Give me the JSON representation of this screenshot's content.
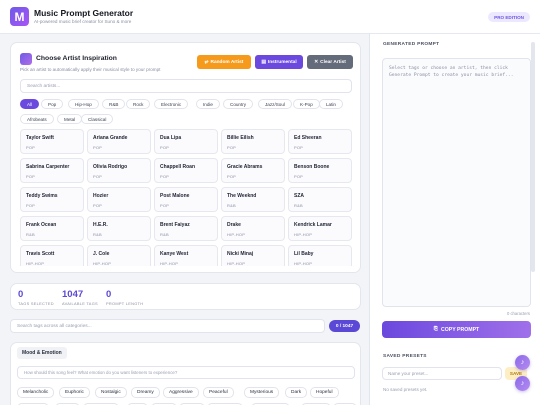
{
  "app": {
    "title": "Music Prompt Generator",
    "subtitle": "AI-powered music brief creator for Suno & more",
    "badge": "PRO EDITION",
    "logo_letter": "M"
  },
  "inspiration": {
    "title": "Choose Artist Inspiration",
    "subtitle": "Pick an artist to automatically apply their musical style to your prompt",
    "random_label": "Random Artist",
    "instrumental_label": "Instrumental",
    "clear_label": "Clear Artist",
    "search_placeholder": "Search artists...",
    "genres": [
      "All",
      "Pop",
      "Hip-Hop",
      "R&B",
      "Rock",
      "Electronic",
      "Indie",
      "Country",
      "Jazz/Soul",
      "K-Pop",
      "Latin",
      "Afrobeats",
      "Metal",
      "Classical"
    ],
    "active_genre": "All",
    "artists": [
      {
        "name": "Taylor Swift",
        "genre": "POP"
      },
      {
        "name": "Ariana Grande",
        "genre": "POP"
      },
      {
        "name": "Dua Lipa",
        "genre": "POP"
      },
      {
        "name": "Billie Eilish",
        "genre": "POP"
      },
      {
        "name": "Ed Sheeran",
        "genre": "POP"
      },
      {
        "name": "Sabrina Carpenter",
        "genre": "POP"
      },
      {
        "name": "Olivia Rodrigo",
        "genre": "POP"
      },
      {
        "name": "Chappell Roan",
        "genre": "POP"
      },
      {
        "name": "Gracie Abrams",
        "genre": "POP"
      },
      {
        "name": "Benson Boone",
        "genre": "POP"
      },
      {
        "name": "Teddy Swims",
        "genre": "POP"
      },
      {
        "name": "Hozier",
        "genre": "POP"
      },
      {
        "name": "Post Malone",
        "genre": "POP"
      },
      {
        "name": "The Weeknd",
        "genre": "R&B"
      },
      {
        "name": "SZA",
        "genre": "R&B"
      },
      {
        "name": "Frank Ocean",
        "genre": "R&B"
      },
      {
        "name": "H.E.R.",
        "genre": "R&B"
      },
      {
        "name": "Brent Faiyaz",
        "genre": "R&B"
      },
      {
        "name": "Drake",
        "genre": "HIP-HOP"
      },
      {
        "name": "Kendrick Lamar",
        "genre": "HIP-HOP"
      },
      {
        "name": "Travis Scott",
        "genre": "HIP-HOP"
      },
      {
        "name": "J. Cole",
        "genre": "HIP-HOP"
      },
      {
        "name": "Kanye West",
        "genre": "HIP-HOP"
      },
      {
        "name": "Nicki Minaj",
        "genre": "HIP-HOP"
      },
      {
        "name": "Lil Baby",
        "genre": "HIP-HOP"
      }
    ]
  },
  "stats": {
    "tags_selected": "0",
    "tags_selected_label": "TAGS SELECTED",
    "available_tags": "1047",
    "available_tags_label": "AVAILABLE TAGS",
    "prompt_length": "0",
    "prompt_length_label": "PROMPT LENGTH"
  },
  "category_search": {
    "placeholder": "Search tags across all categories...",
    "count": "0 / 1047"
  },
  "mood": {
    "tab_label": "Mood & Emotion",
    "input_placeholder": "How should this song feel? What emotion do you want listeners to experience?",
    "chips": [
      "Melancholic",
      "Euphoric",
      "Nostalgic",
      "Dreamy",
      "Aggressive",
      "Peaceful",
      "Mysterious",
      "Dark",
      "Hopeful"
    ],
    "chips_row2": [
      "Romantic",
      "Angry",
      "Bittersweet",
      "Epic",
      "Playful",
      "Lonely",
      "Triumphant",
      "Introspective",
      "Ethereal",
      "Sultry"
    ]
  },
  "generated": {
    "label": "GENERATED PROMPT",
    "placeholder": "Select tags or choose an artist, then click Generate Prompt to create your music brief...",
    "char_count": "0 characters",
    "copy_label": "COPY PROMPT"
  },
  "presets": {
    "label": "SAVED PRESETS",
    "input_placeholder": "Name your preset...",
    "save_label": "SAVE",
    "empty_text": "No saved presets yet."
  },
  "colors": {
    "accent": "#6b48de",
    "random_button": "#f59a1b",
    "clear_button": "#646b7a",
    "stat_number": "#5b48d6"
  }
}
